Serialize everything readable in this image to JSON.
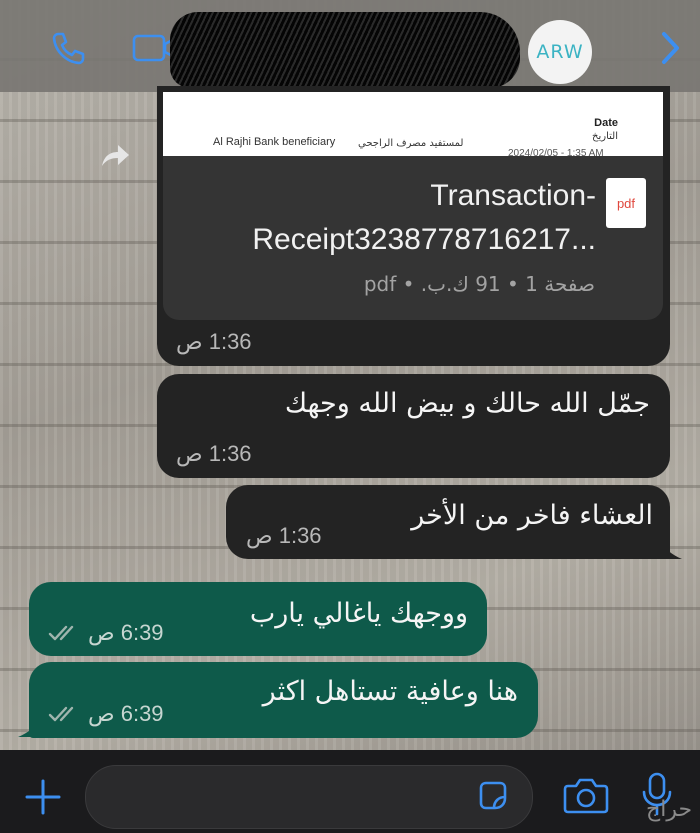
{
  "header": {
    "avatar_text": "ARW"
  },
  "document": {
    "preview_english": "Al Rajhi Bank beneficiary",
    "preview_arabic": "لمستفيد مصرف الراجحي",
    "preview_date_label_en": "Date",
    "preview_date_label_ar": "التاريخ",
    "preview_date_value": "2024/02/05 - 1:35 AM",
    "file_name_line1": "Transaction-",
    "file_name_line2": "Receipt3238778716217...",
    "file_icon_label": "pdf",
    "meta": "صفحة 1 • 91 ك.ب. • pdf",
    "time": "1:36 ص"
  },
  "messages": [
    {
      "direction": "in",
      "text": "جمّل الله حالك و بيض الله وجهك",
      "time": "1:36 ص"
    },
    {
      "direction": "in",
      "text": "العشاء فاخر من الأخر",
      "time": "1:36 ص"
    },
    {
      "direction": "out",
      "text": "ووجهك ياغالي يارب",
      "time": "6:39 ص"
    },
    {
      "direction": "out",
      "text": "هنا وعافية تستاهل اكثر",
      "time": "6:39 ص"
    }
  ],
  "watermark": "حراج",
  "colors": {
    "incoming_bubble": "#232323",
    "outgoing_bubble": "#0e5a4a",
    "accent_blue": "#3d8ff0",
    "header_bg": "#787672"
  }
}
